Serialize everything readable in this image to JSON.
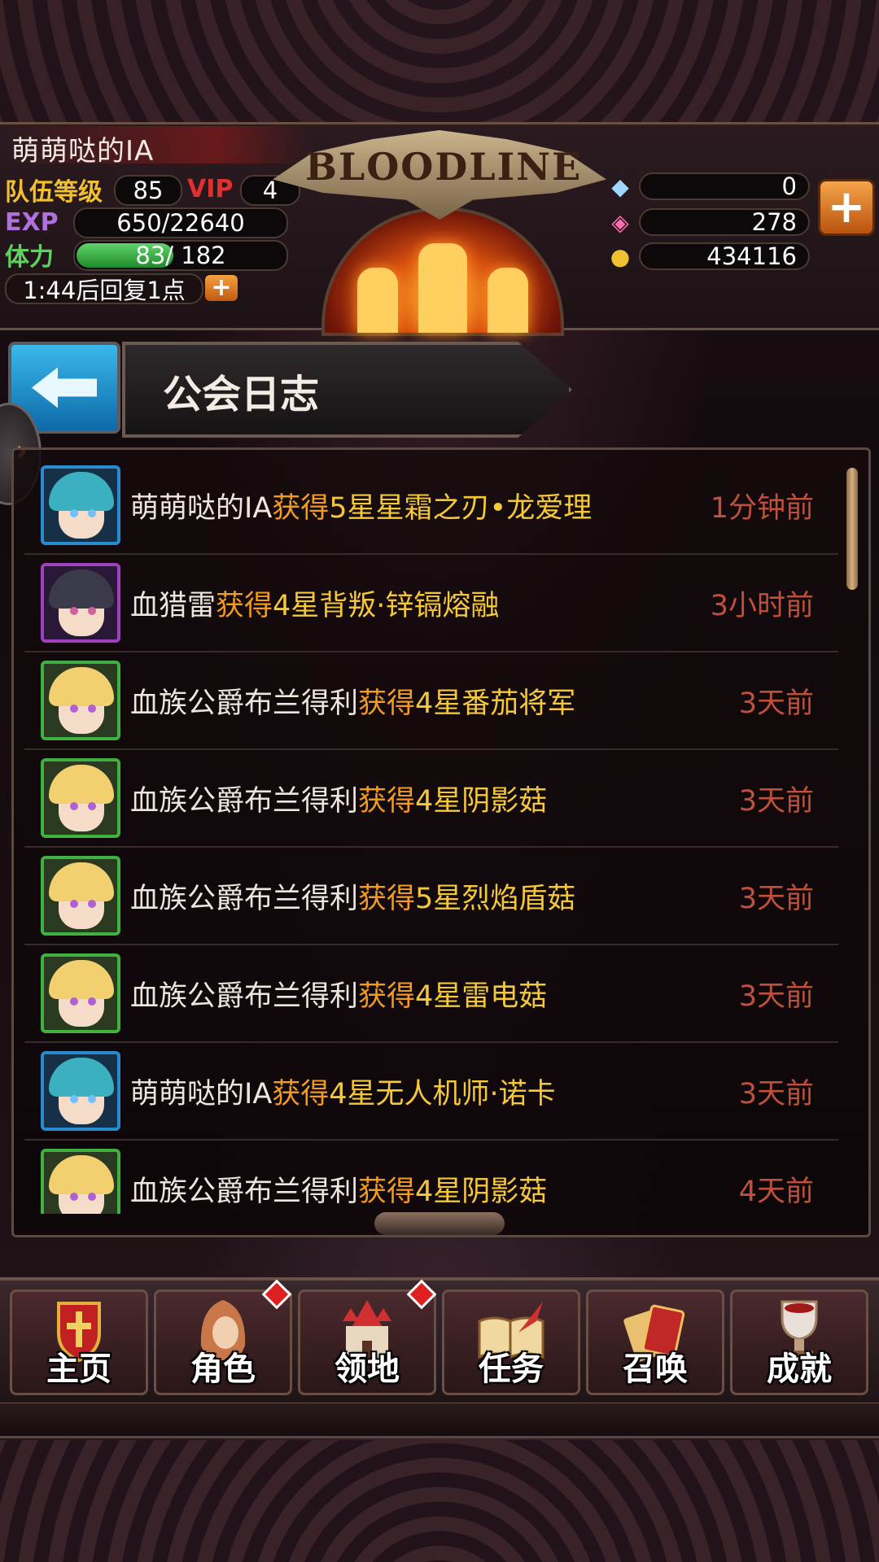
{
  "player": {
    "name": "萌萌哒的IA",
    "level_label": "队伍等级",
    "level": "85",
    "vip_label": "VIP",
    "vip": "4",
    "exp_label": "EXP",
    "exp": "650/22640",
    "stamina_label": "体力",
    "stamina": "83/ 182",
    "stamina_fraction": 0.456,
    "recover": "1:44后回复1点"
  },
  "logo": "BLOODLINE",
  "resources": {
    "crystal": "0",
    "gem": "278",
    "gold": "434116"
  },
  "page": {
    "title": "公会日志"
  },
  "log": [
    {
      "who": "萌萌哒的IA",
      "verb": "获得",
      "item": "5星星霜之刃•龙爱理",
      "time": "1分钟前",
      "avatar": "blue"
    },
    {
      "who": "血猎雷",
      "verb": "获得",
      "item": "4星背叛·锌镉熔融",
      "time": "3小时前",
      "avatar": "purple"
    },
    {
      "who": "血族公爵布兰得利",
      "verb": "获得",
      "item": "4星番茄将军",
      "time": "3天前",
      "avatar": "green"
    },
    {
      "who": "血族公爵布兰得利",
      "verb": "获得",
      "item": "4星阴影菇",
      "time": "3天前",
      "avatar": "green"
    },
    {
      "who": "血族公爵布兰得利",
      "verb": "获得",
      "item": "5星烈焰盾菇",
      "time": "3天前",
      "avatar": "green"
    },
    {
      "who": "血族公爵布兰得利",
      "verb": "获得",
      "item": "4星雷电菇",
      "time": "3天前",
      "avatar": "green"
    },
    {
      "who": "萌萌哒的IA",
      "verb": "获得",
      "item": "4星无人机师·诺卡",
      "time": "3天前",
      "avatar": "blue"
    },
    {
      "who": "血族公爵布兰得利",
      "verb": "获得",
      "item": "4星阴影菇",
      "time": "4天前",
      "avatar": "green"
    }
  ],
  "nav": [
    {
      "label": "主页",
      "icon": "shield-cross-icon"
    },
    {
      "label": "角色",
      "icon": "hooded-figure-icon"
    },
    {
      "label": "领地",
      "icon": "castle-icon"
    },
    {
      "label": "任务",
      "icon": "book-quill-icon"
    },
    {
      "label": "召唤",
      "icon": "cards-icon"
    },
    {
      "label": "成就",
      "icon": "trophy-icon"
    }
  ],
  "colors": {
    "verb": "#f39a22",
    "item": "#f5c83a",
    "time": "#c0503a",
    "accent": "#f5a040"
  }
}
